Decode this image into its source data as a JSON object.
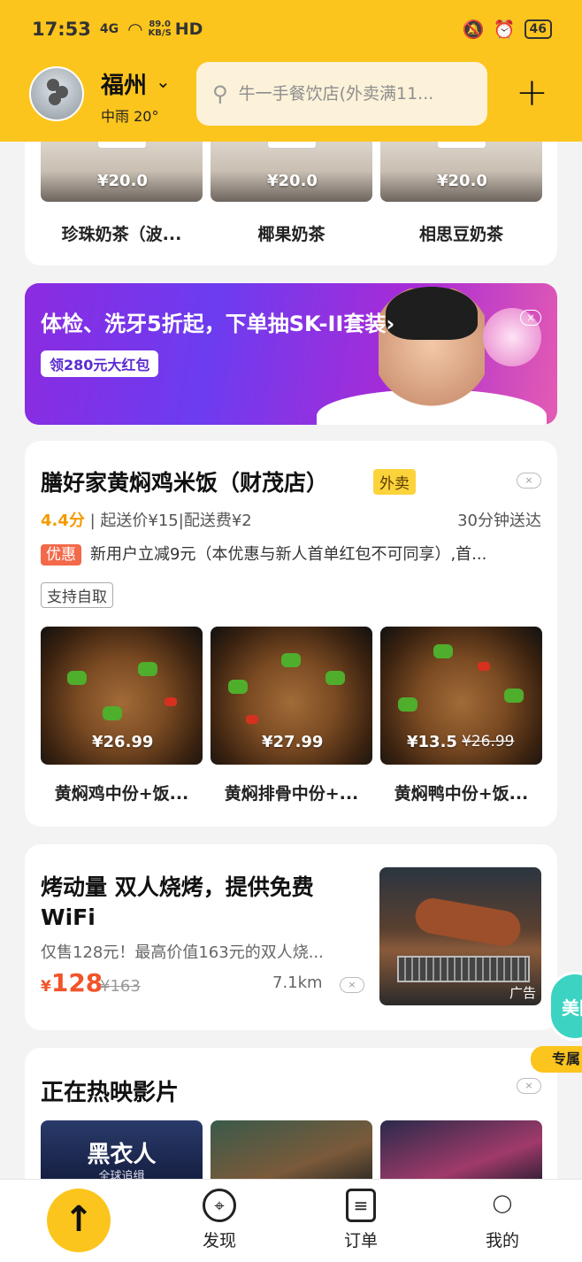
{
  "status": {
    "time": "17:53",
    "signal": "4G",
    "speed_value": "89.0",
    "speed_unit": "KB/S",
    "hd": "HD",
    "battery": "46"
  },
  "header": {
    "city": "福州",
    "weather": "中雨 20°",
    "search_placeholder": "牛一手餐饮店(外卖满11..."
  },
  "tea_items": [
    {
      "price": "¥20.0",
      "name": "珍珠奶茶（波..."
    },
    {
      "price": "¥20.0",
      "name": "椰果奶茶"
    },
    {
      "price": "¥20.0",
      "name": "相思豆奶茶"
    }
  ],
  "banner": {
    "title": "体检、洗牙5折起，下单抽SK-II套装›",
    "pill": "领280元大红包",
    "close": "×"
  },
  "shop": {
    "name": "膳好家黄焖鸡米饭（财茂店）",
    "tag": "外卖",
    "score": "4.4分",
    "meta": " | 起送价¥15|配送费¥2",
    "eta": "30分钟送达",
    "promo_badge": "优惠",
    "promo_text": "新用户立减9元（本优惠与新人首单红包不可同享）,首...",
    "self_pickup": "支持自取",
    "close": "×",
    "items": [
      {
        "price": "¥26.99",
        "name": "黄焖鸡中份+饭..."
      },
      {
        "price": "¥27.99",
        "name": "黄焖排骨中份+..."
      },
      {
        "price": "¥13.5",
        "old_price": "¥26.99",
        "name": "黄焖鸭中份+饭..."
      }
    ]
  },
  "ad": {
    "title": "烤动量 双人烧烤，提供免费WiFi",
    "subtitle": "仅售128元！最高价值163元的双人烧...",
    "currency": "¥",
    "price": "128",
    "old_price": "¥163",
    "distance": "7.1km",
    "ad_label": "广告",
    "close": "×"
  },
  "movies": {
    "title": "正在热映影片",
    "close": "×",
    "poster1_title": "黑衣人",
    "poster1_sub": "全球追缉"
  },
  "floater": {
    "label": "美团",
    "ribbon": "专属"
  },
  "bottom_nav": {
    "up": "↑",
    "items": [
      {
        "label": "发现",
        "icon": "⌖"
      },
      {
        "label": "订单",
        "icon": "≡"
      },
      {
        "label": "我的",
        "icon": "◯"
      }
    ]
  },
  "colors": {
    "brand_yellow": "#fcc51d",
    "price_red": "#f2542a",
    "score_orange": "#f39b00",
    "promo_red": "#f26a4a"
  }
}
